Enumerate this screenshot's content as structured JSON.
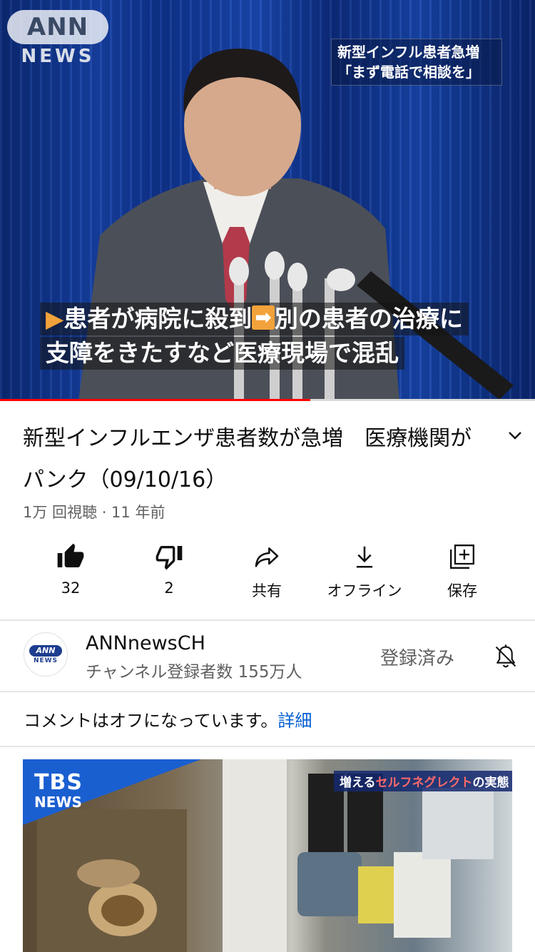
{
  "player": {
    "logo_top": "ANN",
    "logo_bottom": "NEWS",
    "headline_line1": "新型インフル患者急増",
    "headline_line2": "「まず電話で相談を」",
    "caption_line1_a": "患者が病院に殺到",
    "caption_line1_b": "別の患者の治療に",
    "caption_line2": "支障をきたすなど医療現場で混乱",
    "progress": 0.58
  },
  "video": {
    "title": "新型インフルエンザ患者数が急増　医療機関がパンク（09/10/16）",
    "meta": "1万 回視聴 · 11 年前"
  },
  "actions": [
    {
      "icon": "thumbs-up-icon",
      "label": "32"
    },
    {
      "icon": "thumbs-down-icon",
      "label": "2"
    },
    {
      "icon": "share-icon",
      "label": "共有"
    },
    {
      "icon": "download-icon",
      "label": "オフライン"
    },
    {
      "icon": "save-playlist-icon",
      "label": "保存"
    }
  ],
  "channel": {
    "avatar_top": "ANN",
    "avatar_bottom": "NEWS",
    "name": "ANNnewsCH",
    "subscribers": "チャンネル登録者数 155万人",
    "subscribed_label": "登録済み"
  },
  "comments": {
    "text": "コメントはオフになっています。",
    "link": "詳細"
  },
  "next_video": {
    "logo_top": "TBS",
    "logo_bottom": "NEWS",
    "tag_a": "増える",
    "tag_b": "セルフネグレクト",
    "tag_c": "の実態"
  },
  "colors": {
    "progress": "#ff0000",
    "link": "#065fd4",
    "tbs_blue": "#1a5fd0"
  }
}
